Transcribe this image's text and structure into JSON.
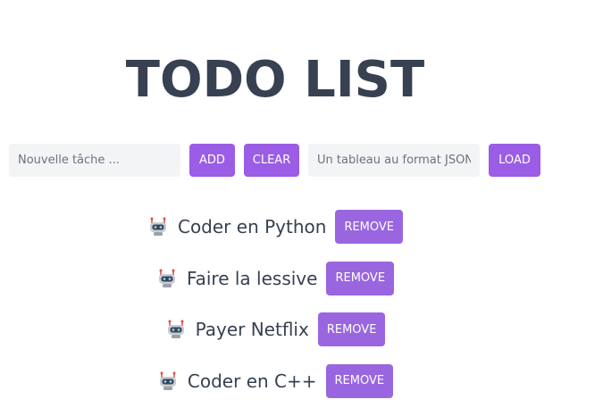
{
  "app": {
    "title": "TODO LIST"
  },
  "controls": {
    "task_placeholder": "Nouvelle tâche ...",
    "add_label": "ADD",
    "clear_label": "CLEAR",
    "json_placeholder": "Un tableau au format JSON",
    "load_label": "LOAD"
  },
  "todos": [
    {
      "text": "Coder en Python",
      "icon": "robot-icon",
      "remove_label": "REMOVE"
    },
    {
      "text": "Faire la lessive",
      "icon": "robot-icon",
      "remove_label": "REMOVE"
    },
    {
      "text": "Payer Netflix",
      "icon": "robot-icon",
      "remove_label": "REMOVE"
    },
    {
      "text": "Coder en C++",
      "icon": "robot-icon",
      "remove_label": "REMOVE"
    }
  ],
  "colors": {
    "accent": "#9966e0",
    "text": "#374151",
    "input_bg": "#f3f4f6"
  }
}
